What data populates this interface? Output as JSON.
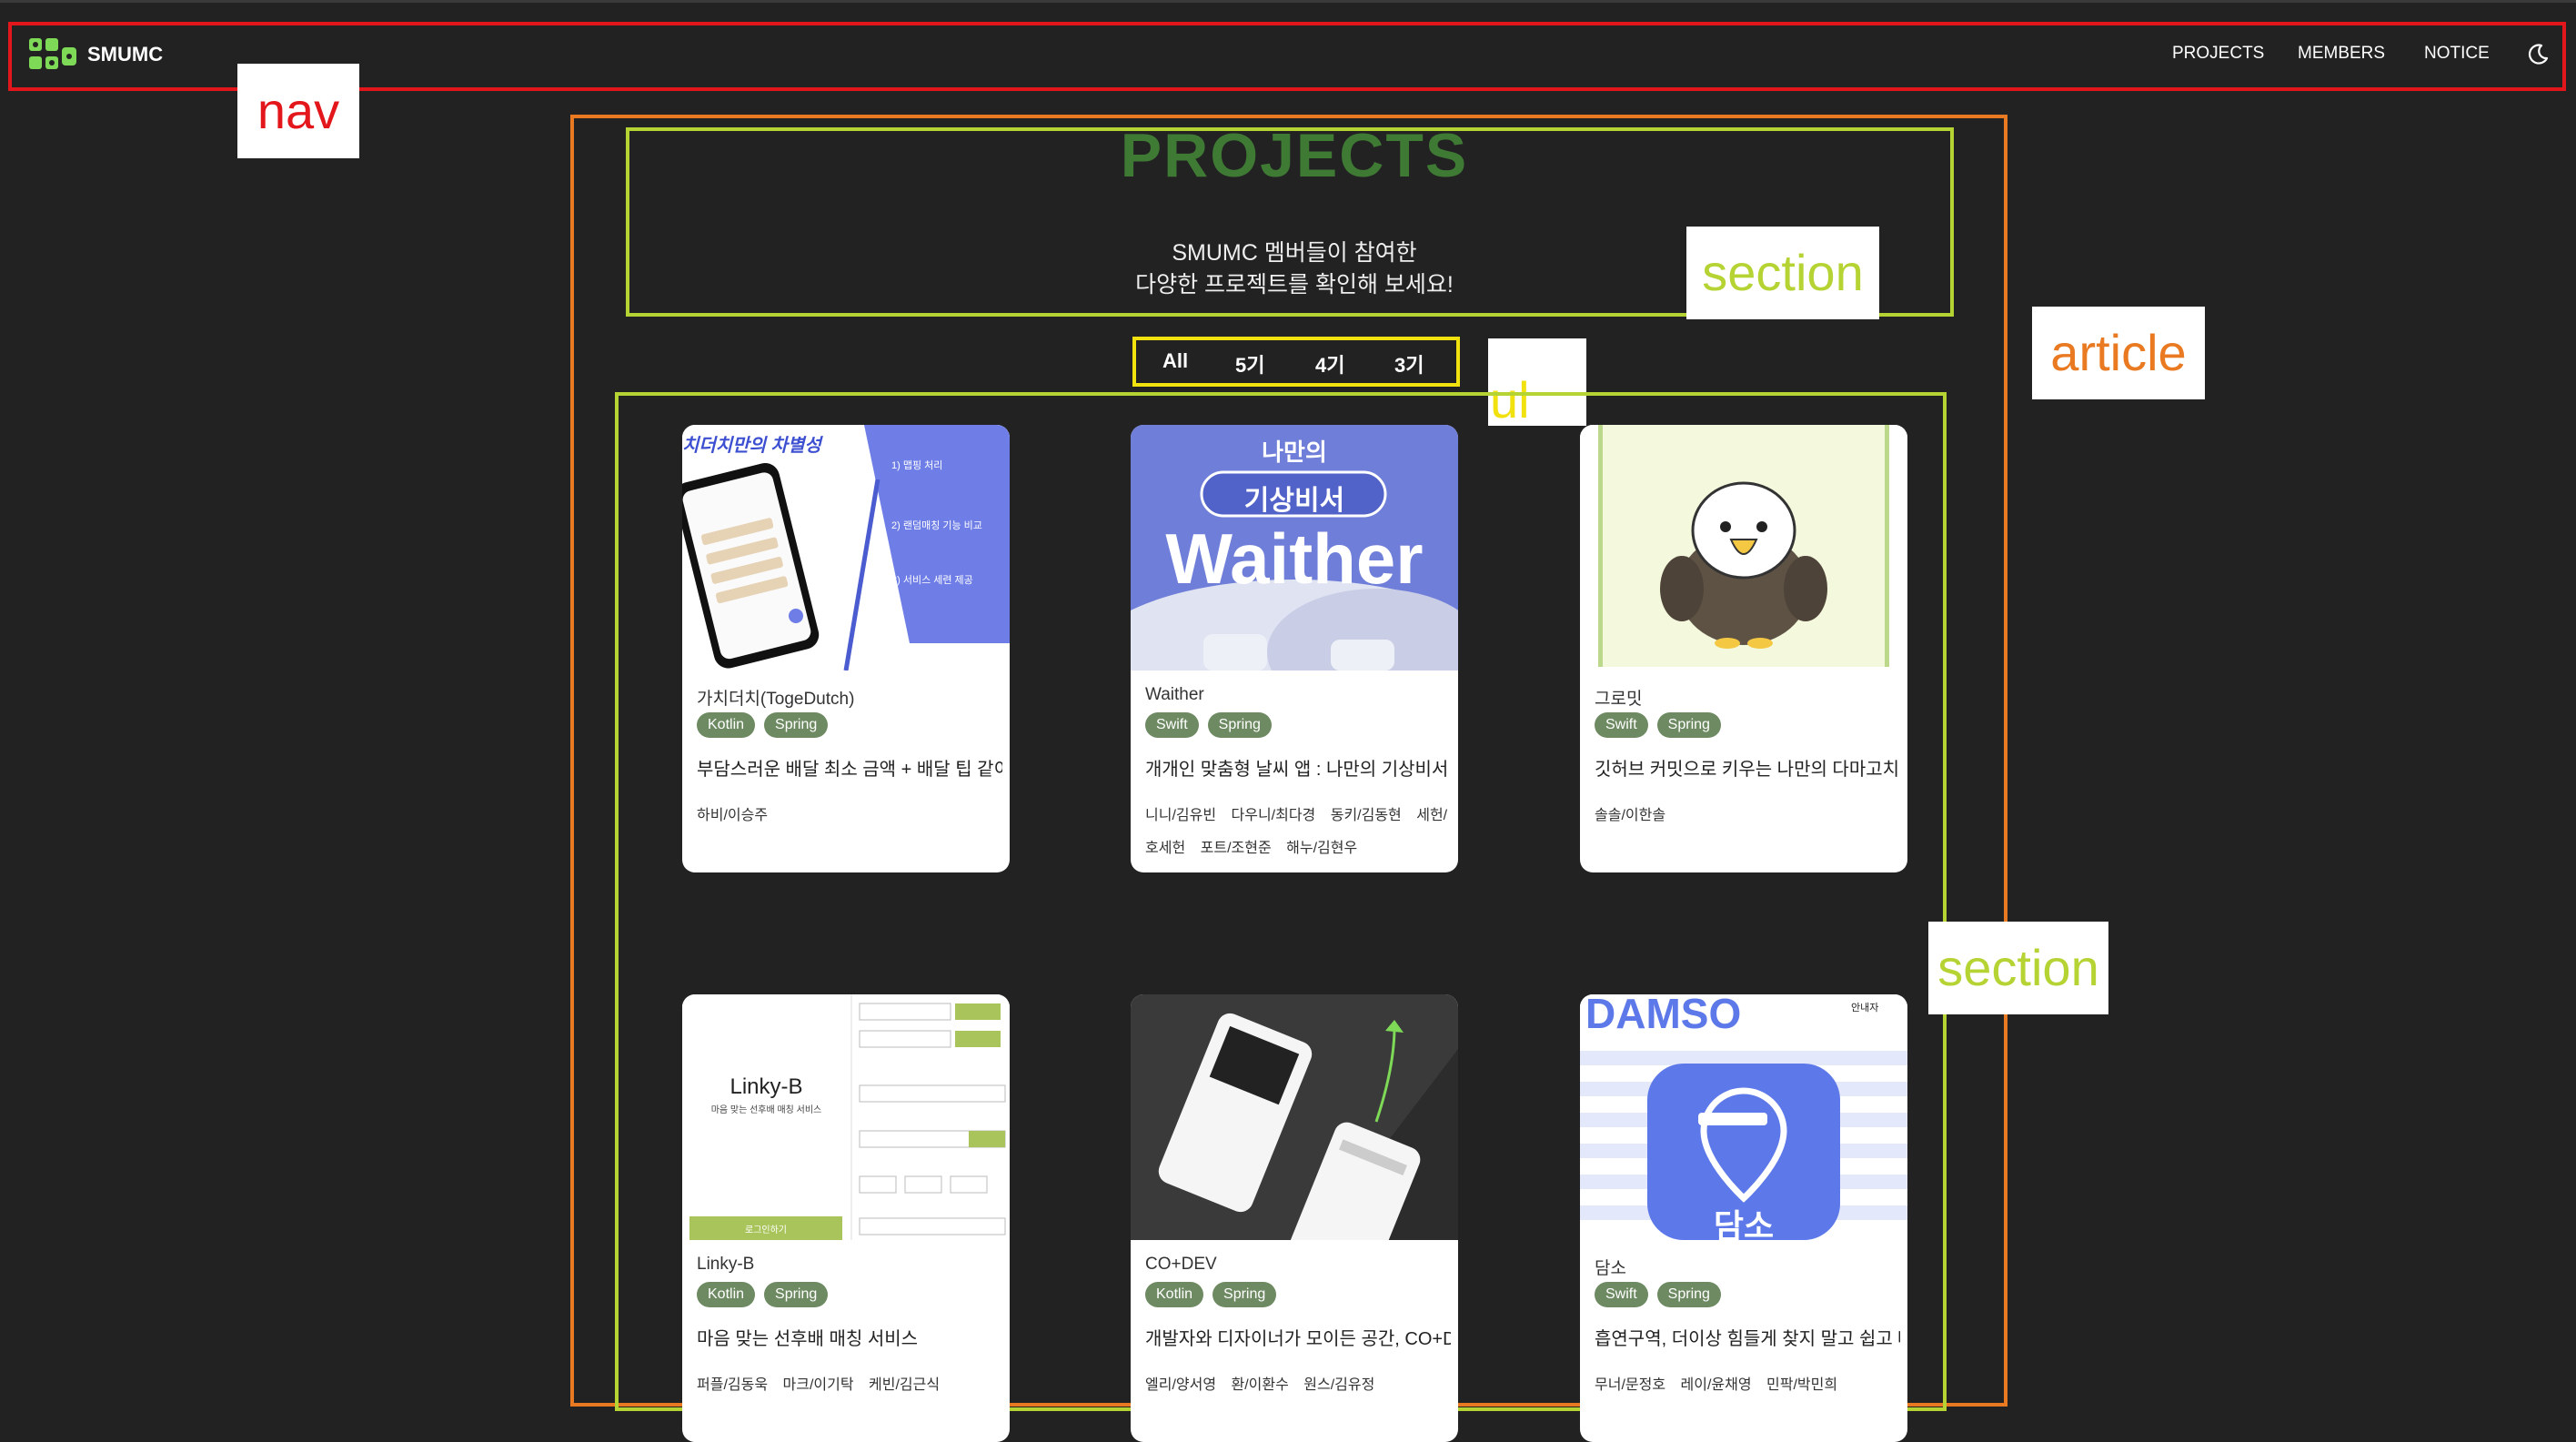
{
  "nav": {
    "brand": "SMUMC",
    "menu": [
      "PROJECTS",
      "MEMBERS",
      "NOTICE"
    ],
    "theme_icon": "moon-icon"
  },
  "annotations": {
    "nav": "nav",
    "section_top": "section",
    "article": "article",
    "ul": "ul",
    "section_cards": "section"
  },
  "header": {
    "title": "PROJECTS",
    "subtitle_line1": "SMUMC 멤버들이 참여한",
    "subtitle_line2": "다양한 프로젝트를 확인해 보세요!"
  },
  "filters": [
    "All",
    "5기",
    "4기",
    "3기"
  ],
  "projects": [
    {
      "title": "가치더치(TogeDutch)",
      "tags": [
        "Kotlin",
        "Spring"
      ],
      "description": "부담스러운 배달 최소 금액 + 배달 팁 같이 나눠요",
      "members": [
        "하비/이승주"
      ],
      "image_text": [
        "치더치만의 차별성",
        "1) 맵핑 처리",
        "2) 랜덤매칭 기능 비교",
        "3) 서비스 세련 제공"
      ]
    },
    {
      "title": "Waither",
      "tags": [
        "Swift",
        "Spring"
      ],
      "description": "개개인 맞춤형 날씨 앱 : 나만의 기상비서 웨더",
      "members": [
        "니니/김유빈",
        "다우니/최다경",
        "동키/김동현",
        "세헌/호세헌",
        "포트/조현준",
        "해누/김현우"
      ],
      "image_text": [
        "나만의",
        "기상비서",
        "Waither"
      ]
    },
    {
      "title": "그로밋",
      "tags": [
        "Swift",
        "Spring"
      ],
      "description": "깃허브 커밋으로 키우는 나만의 다마고치",
      "members": [
        "솔솔/이한솔"
      ],
      "image_text": []
    },
    {
      "title": "Linky-B",
      "tags": [
        "Kotlin",
        "Spring"
      ],
      "description": "마음 맞는 선후배 매칭 서비스",
      "members": [
        "퍼플/김동욱",
        "마크/이기탁",
        "케빈/김근식"
      ],
      "image_text": [
        "Linky-B",
        "마음 맞는 선후배 매칭 서비스",
        "로그인하기"
      ]
    },
    {
      "title": "CO+DEV",
      "tags": [
        "Kotlin",
        "Spring"
      ],
      "description": "개발자와 디자이너가 모이든 공간, CO+DEV",
      "members": [
        "엘리/양서영",
        "환/이환수",
        "원스/김유정"
      ],
      "image_text": []
    },
    {
      "title": "담소",
      "tags": [
        "Swift",
        "Spring"
      ],
      "description": "흡연구역, 더이상 힘들게 찾지 말고 쉽고 빠르게",
      "members": [
        "무너/문정호",
        "레이/윤채영",
        "민팍/박민희"
      ],
      "image_text": [
        "DAMSO",
        "안내자",
        "담소"
      ]
    }
  ],
  "colors": {
    "background": "#222222",
    "title_green": "#3f7a34",
    "badge_green": "#6e8a62",
    "nav_outline": "#e3161b",
    "article_outline": "#e97a22",
    "section_outline": "#b6d334",
    "ul_outline": "#f1e10e"
  }
}
